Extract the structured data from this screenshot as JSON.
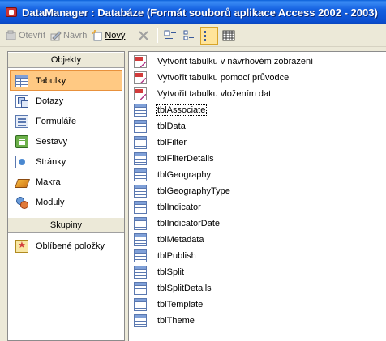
{
  "window": {
    "title": "DataManager : Databáze (Formát souborů aplikace Access 2002 - 2003)"
  },
  "toolbar": {
    "open_label": "Otevřít",
    "design_label": "Návrh",
    "new_label": "Nový"
  },
  "sidebar": {
    "objects_header": "Objekty",
    "groups_header": "Skupiny",
    "items": [
      {
        "label": "Tabulky",
        "icon": "table-icon",
        "selected": true
      },
      {
        "label": "Dotazy",
        "icon": "query-icon"
      },
      {
        "label": "Formuláře",
        "icon": "form-icon"
      },
      {
        "label": "Sestavy",
        "icon": "report-icon"
      },
      {
        "label": "Stránky",
        "icon": "page-icon"
      },
      {
        "label": "Makra",
        "icon": "macro-icon"
      },
      {
        "label": "Moduly",
        "icon": "module-icon"
      }
    ],
    "group_items": [
      {
        "label": "Oblíbené položky",
        "icon": "favorites-icon"
      }
    ]
  },
  "objects": {
    "shortcuts": [
      "Vytvořit tabulku v návrhovém zobrazení",
      "Vytvořit tabulku pomocí průvodce",
      "Vytvořit tabulku vložením dat"
    ],
    "tables": [
      "tblAssociate",
      "tblData",
      "tblFilter",
      "tblFilterDetails",
      "tblGeography",
      "tblGeographyType",
      "tblIndicator",
      "tblIndicatorDate",
      "tblMetadata",
      "tblPublish",
      "tblSplit",
      "tblSplitDetails",
      "tblTemplate",
      "tblTheme"
    ],
    "focused_item": "tblAssociate"
  }
}
